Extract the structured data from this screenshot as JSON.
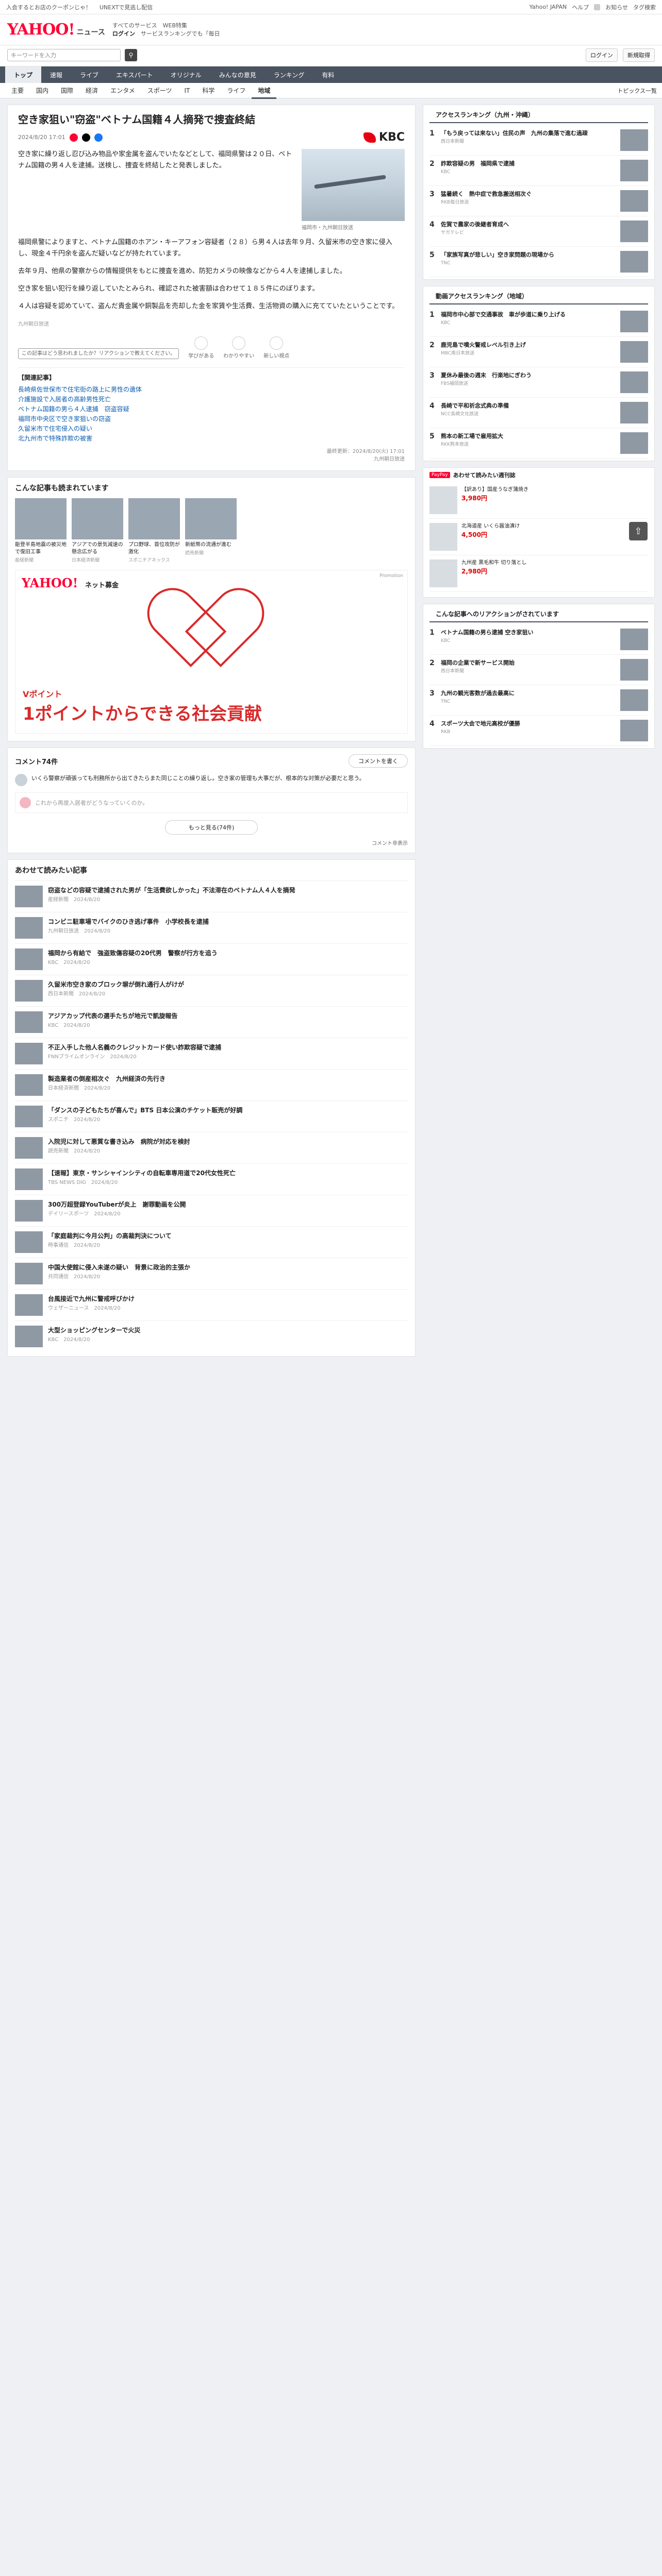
{
  "topbar": {
    "left": [
      "入会するとお店のクーポンじゃ！",
      "UNEXTで見逃し配信"
    ],
    "right": [
      "Yahoo! JAPAN",
      "ヘルプ",
      "お知らせ",
      "タグ検索"
    ]
  },
  "header": {
    "logo": "YAHOO!",
    "logo_sub": "ニュース",
    "links": [
      "すべてのサービス",
      "WEB特集"
    ],
    "login": "ログイン",
    "register": "サービスランキングでも「毎日"
  },
  "search": {
    "placeholder": "キーワードを入力",
    "icon": "search-icon"
  },
  "account": [
    "ログイン",
    "新規取得"
  ],
  "nav1": [
    "トップ",
    "速報",
    "ライブ",
    "エキスパート",
    "オリジナル",
    "みんなの意見",
    "ランキング",
    "有料"
  ],
  "nav1_active": "トップ",
  "nav2": [
    "主要",
    "国内",
    "国際",
    "経済",
    "エンタメ",
    "スポーツ",
    "IT",
    "科学",
    "ライフ",
    "地域"
  ],
  "nav2_active": "地域",
  "nav2_right": "トピックス一覧",
  "article": {
    "title": "空き家狙い\"窃盗\"ベトナム国籍４人摘発で捜査終結",
    "date": "2024/8/20 17:01",
    "source": "KBC",
    "lead": "空き家に繰り返し忍び込み物品や家金属を盗んでいたなどとして、福岡県警は２０日、ベトナム国籍の男４人を逮捕。送検し、捜査を終結したと発表しました。",
    "photo_caption": "福岡市・九州朝日放送",
    "paragraphs": [
      "福岡県警によりますと、ベトナム国籍のホアン・キーアフォン容疑者（２８）ら男４人は去年９月、久留米市の空き家に侵入し、現金４千円余を盗んだ疑いなどが持たれています。",
      "去年９月、他県の警察からの情報提供をもとに捜査を進め、防犯カメラの映像などから４人を逮捕しました。",
      "空き家を狙い犯行を繰り返していたとみられ、確認された被害額は合わせて１８５件にのぼります。",
      "４人は容疑を認めていて、盗んだ貴金属や銅製品を売却した金を家賃や生活費、生活物資の購入に充てていたということです。"
    ],
    "note": "九州朝日放送",
    "reaction_bubble": "この記事はどう思われましたか？リアクションで教えてください。",
    "reactions": [
      "学びがある",
      "わかりやすい",
      "新しい視点"
    ],
    "related_title": "【関連記事】",
    "related": [
      "長崎県佐世保市で住宅街の路上に男性の遺体",
      "介護施設で入居者の高齢男性死亡",
      "ベトナム国籍の男ら４人逮捕　窃盗容疑",
      "福岡市中央区で空き家狙いの窃盗",
      "久留米市で住宅侵入の疑い",
      "北九州市で特殊詐欺の被害"
    ],
    "foot": [
      "最終更新：2024/8/20(火) 17:01",
      "九州朝日放送"
    ]
  },
  "recommend": {
    "title": "こんな記事も読まれています",
    "items": [
      {
        "t": "能登半島地震の被災地で復旧工事",
        "s": "産経新聞"
      },
      {
        "t": "アジアでの景気減速の懸念広がる",
        "s": "日本経済新聞"
      },
      {
        "t": "プロ野球、首位攻防が激化",
        "s": "スポニチアネックス"
      },
      {
        "t": "新紙幣の流通が進む",
        "s": "読売新聞"
      }
    ]
  },
  "ad": {
    "logo": "YAHOO!",
    "sub": "ネット募金",
    "tag": "Promotion",
    "cta_small": "Vポイント",
    "cta": "1ポイントからできる社会貢献"
  },
  "comments": {
    "title": "コメント74件",
    "write": "コメントを書く",
    "first": "いくら警察が頑張っても刑務所から出てきたらまた同じことの繰り返し。空き家の管理も大事だが、根本的な対策が必要だと思う。",
    "input": "これから再度入居者がどうなっていくのか。",
    "more": "もっと見る(74件)",
    "note": "コメント非表示"
  },
  "feed": {
    "title": "あわせて読みたい記事",
    "items": [
      {
        "t": "窃盗などの容疑で逮捕された男が「生活費欲しかった」不法滞在のベトナム人４人を摘発",
        "s": "産経新聞　2024/8/20"
      },
      {
        "t": "コンビニ駐車場でバイクのひき逃げ事件　小学校長を逮捕",
        "s": "九州朝日放送　2024/8/20"
      },
      {
        "t": "福岡から有給で　強盗致傷容疑の20代男　警察が行方を追う",
        "s": "KBC　2024/8/20"
      },
      {
        "t": "久留米市空き家のブロック塀が倒れ通行人がけが",
        "s": "西日本新聞　2024/8/20"
      },
      {
        "t": "アジアカップ代表の選手たちが地元で凱旋報告",
        "s": "KBC　2024/8/20"
      },
      {
        "t": "不正入手した他人名義のクレジットカード使い詐欺容疑で逮捕",
        "s": "FNNプライムオンライン　2024/8/20"
      },
      {
        "t": "製造業者の倒産相次ぐ　九州経済の先行き",
        "s": "日本経済新聞　2024/8/20"
      },
      {
        "t": "「ダンスの子どもたちが喜んで」BTS 日本公演のチケット販売が好調",
        "s": "スポニチ　2024/8/20"
      },
      {
        "t": "入院児に対して悪質な書き込み　病院が対応を検討",
        "s": "読売新聞　2024/8/20"
      },
      {
        "t": "【速報】東京・サンシャインシティの自転車専用道で20代女性死亡",
        "s": "TBS NEWS DIG　2024/8/20"
      },
      {
        "t": "300万超登録YouTuberが炎上　謝罪動画を公開",
        "s": "デイリースポーツ　2024/8/20"
      },
      {
        "t": "「家庭裁判に今月公判」の高裁判決について",
        "s": "時事通信　2024/8/20"
      },
      {
        "t": "中国大使館に侵入未遂の疑い　背景に政治的主張か",
        "s": "共同通信　2024/8/20"
      },
      {
        "t": "台風接近で九州に警戒呼びかけ",
        "s": "ウェザーニュース　2024/8/20"
      },
      {
        "t": "大型ショッピングセンターで火災",
        "s": "KBC　2024/8/20"
      }
    ]
  },
  "side_access": {
    "title": "アクセスランキング（九州・沖縄）",
    "items": [
      {
        "n": "1",
        "t": "「もう戻っては来ない」住民の声　九州の集落で進む過疎",
        "s": "西日本新聞"
      },
      {
        "n": "2",
        "t": "詐欺容疑の男　福岡県で逮捕",
        "s": "KBC"
      },
      {
        "n": "3",
        "t": "猛暑続く　熱中症で救急搬送相次ぐ",
        "s": "RKB毎日放送"
      },
      {
        "n": "4",
        "t": "佐賀で農家の後継者育成へ",
        "s": "サガテレビ"
      },
      {
        "n": "5",
        "t": "「家族写真が悲しい」空き家問題の現場から",
        "s": "TNC"
      }
    ]
  },
  "side_video": {
    "title": "動画アクセスランキング（地域）",
    "items": [
      {
        "n": "1",
        "t": "福岡市中心部で交通事故　車が歩道に乗り上げる",
        "s": "KBC"
      },
      {
        "n": "2",
        "t": "鹿児島で噴火警戒レベル引き上げ",
        "s": "MBC南日本放送"
      },
      {
        "n": "3",
        "t": "夏休み最後の週末　行楽地にぎわう",
        "s": "FBS福岡放送"
      },
      {
        "n": "4",
        "t": "長崎で平和祈念式典の準備",
        "s": "NCC長崎文化放送"
      },
      {
        "n": "5",
        "t": "熊本の新工場で雇用拡大",
        "s": "RKK熊本放送"
      }
    ]
  },
  "side_pay": {
    "badge": "PayPay",
    "title": "あわせて読みたい週刊誌",
    "items": [
      {
        "t": "【訳あり】国産うなぎ蒲焼き",
        "p": "3,980円"
      },
      {
        "t": "北海道産 いくら醤油漬け",
        "p": "4,500円"
      },
      {
        "t": "九州産 黒毛和牛 切り落とし",
        "p": "2,980円"
      }
    ]
  },
  "side_reaction": {
    "title": "こんな記事へのリアクションがされています",
    "items": [
      {
        "n": "1",
        "t": "ベトナム国籍の男ら逮捕 空き家狙い",
        "s": "KBC"
      },
      {
        "n": "2",
        "t": "福岡の企業で新サービス開始",
        "s": "西日本新聞"
      },
      {
        "n": "3",
        "t": "九州の観光客数が過去最高に",
        "s": "TNC"
      },
      {
        "n": "4",
        "t": "スポーツ大会で地元高校が優勝",
        "s": "RKB"
      }
    ]
  },
  "scroll_top": "arrow-up-icon"
}
